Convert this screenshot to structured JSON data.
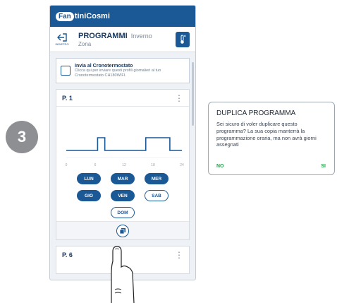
{
  "step": "3",
  "app": {
    "logo_badge": "Fan",
    "logo_text": "tiniCosmi"
  },
  "header": {
    "back_label": "INDIETRO",
    "title": "PROGRAMMI",
    "mode": "Inverno",
    "zone": "Zona"
  },
  "info_card": {
    "title": "Invia al Cronotermostato",
    "text": "Clicca qui per inviare questi profili giornalieri al tuo Cronotermostato CH180WIFI."
  },
  "program_card": {
    "name": "P. 1",
    "days_row1": [
      "LUN",
      "MAR",
      "MER"
    ],
    "days_row2": [
      "GIO",
      "VEN",
      "SAB"
    ],
    "days_row3": [
      "DOM"
    ],
    "days_selected": {
      "LUN": true,
      "MAR": true,
      "MER": true,
      "GIO": true,
      "VEN": true,
      "SAB": false,
      "DOM": false
    }
  },
  "program_card_2": {
    "name": "P. 6"
  },
  "chart_data": {
    "type": "line",
    "x_ticks": [
      "0",
      "6",
      "12",
      "18",
      "24"
    ],
    "xlim": [
      0,
      24
    ],
    "levels": [
      "low",
      "high"
    ],
    "points": [
      {
        "x": 0,
        "level": "low"
      },
      {
        "x": 6.5,
        "level": "low"
      },
      {
        "x": 6.5,
        "level": "high"
      },
      {
        "x": 8,
        "level": "high"
      },
      {
        "x": 8,
        "level": "low"
      },
      {
        "x": 16.5,
        "level": "low"
      },
      {
        "x": 16.5,
        "level": "high"
      },
      {
        "x": 21.5,
        "level": "high"
      },
      {
        "x": 21.5,
        "level": "low"
      },
      {
        "x": 24,
        "level": "low"
      }
    ]
  },
  "dialog": {
    "title": "DUPLICA PROGRAMMA",
    "body": "Sei sicuro di voler duplicare questo programma? La sua copia manterrà la programmazione oraria, ma non avrà giorni assegnati",
    "no": "NO",
    "yes": "SI"
  },
  "colors": {
    "brand": "#1a5896",
    "confirm": "#22a04b",
    "badge": "#8d8f92"
  }
}
